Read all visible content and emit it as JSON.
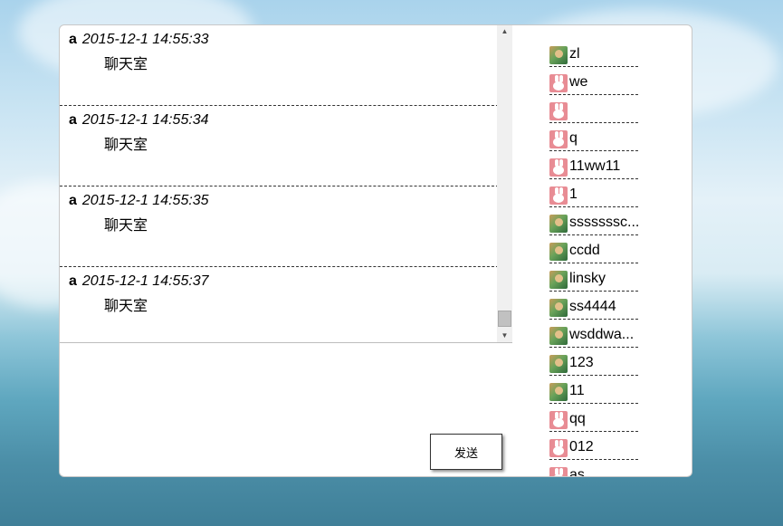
{
  "messages": [
    {
      "user": "a",
      "time": "2015-12-1 14:55:33",
      "text": "聊天室"
    },
    {
      "user": "a",
      "time": "2015-12-1 14:55:34",
      "text": "聊天室"
    },
    {
      "user": "a",
      "time": "2015-12-1 14:55:35",
      "text": "聊天室"
    },
    {
      "user": "a",
      "time": "2015-12-1 14:55:37",
      "text": "聊天室"
    }
  ],
  "send_label": "发送",
  "users": [
    {
      "name": "zl",
      "avatar": "green"
    },
    {
      "name": "we",
      "avatar": "pink"
    },
    {
      "name": "",
      "avatar": "pink"
    },
    {
      "name": "q",
      "avatar": "pink"
    },
    {
      "name": "11ww11",
      "avatar": "pink"
    },
    {
      "name": "1",
      "avatar": "pink"
    },
    {
      "name": "sssssssc...",
      "avatar": "green"
    },
    {
      "name": "ccdd",
      "avatar": "green"
    },
    {
      "name": "linsky",
      "avatar": "green"
    },
    {
      "name": "ss4444",
      "avatar": "green"
    },
    {
      "name": "wsddwa...",
      "avatar": "green"
    },
    {
      "name": "123",
      "avatar": "green"
    },
    {
      "name": "11",
      "avatar": "green"
    },
    {
      "name": "qq",
      "avatar": "pink"
    },
    {
      "name": "012",
      "avatar": "pink"
    },
    {
      "name": "as",
      "avatar": "pink"
    }
  ],
  "icons": {
    "scroll_up": "triangle-up-icon",
    "scroll_down": "triangle-down-icon"
  },
  "colors": {
    "panel_bg": "#ffffff",
    "divider": "#333333"
  }
}
